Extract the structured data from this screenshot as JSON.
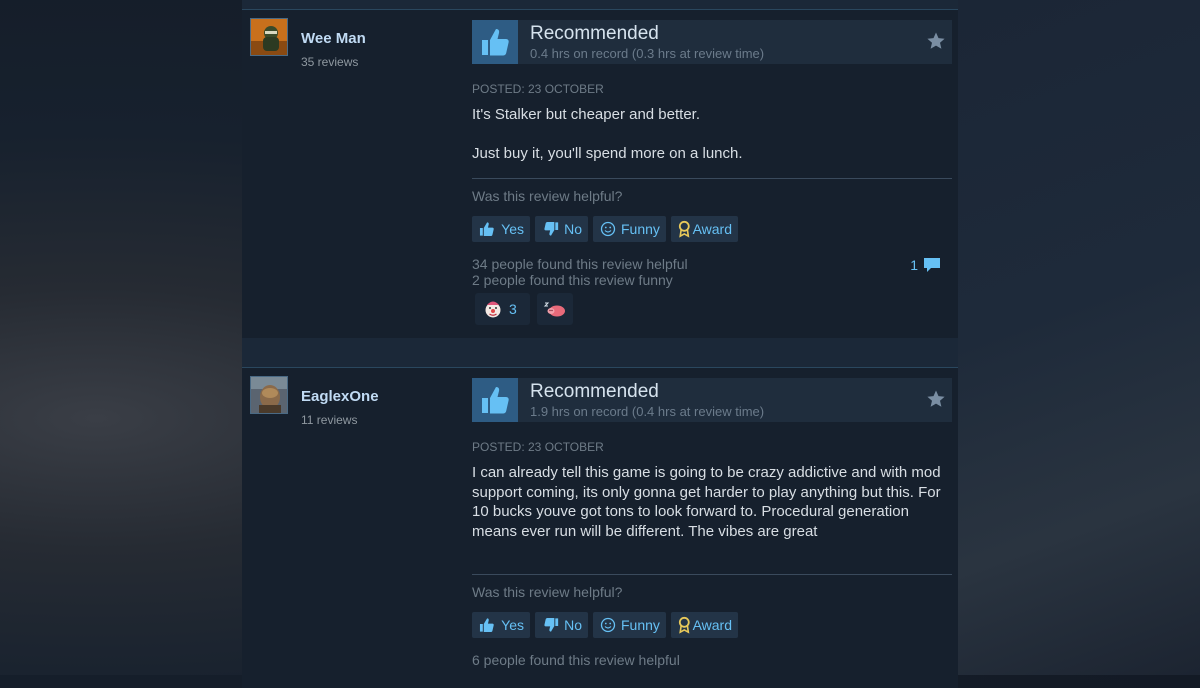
{
  "reviews": [
    {
      "author": "Wee Man",
      "author_reviews": "35 reviews",
      "verdict": "Recommended",
      "hours": "0.4 hrs on record (0.3 hrs at review time)",
      "posted": "Posted: 23 October",
      "body": [
        "It's Stalker but cheaper and better.",
        "Just buy it, you'll spend more on a lunch."
      ],
      "helpful_question": "Was this review helpful?",
      "buttons": {
        "yes": "Yes",
        "no": "No",
        "funny": "Funny",
        "award": "Award"
      },
      "helpful_count": "34 people found this review helpful",
      "funny_count": "2 people found this review funny",
      "comment_count": "1",
      "reactions": [
        {
          "icon": "clown-face-icon",
          "count": "3"
        },
        {
          "icon": "sleepy-pig-icon",
          "count": ""
        }
      ]
    },
    {
      "author": "EaglexOne",
      "author_reviews": "11 reviews",
      "verdict": "Recommended",
      "hours": "1.9 hrs on record (0.4 hrs at review time)",
      "posted": "Posted: 23 October",
      "body": [
        "I can already tell this game is going to be crazy addictive and with mod support coming, its only gonna get harder to play anything but this. For 10 bucks youve got tons to look forward to. Procedural generation means ever run will be different. The vibes are great"
      ],
      "helpful_question": "Was this review helpful?",
      "buttons": {
        "yes": "Yes",
        "no": "No",
        "funny": "Funny",
        "award": "Award"
      },
      "helpful_count": "6 people found this review helpful"
    }
  ],
  "colors": {
    "link_blue": "#66c0f4",
    "panel": "#16202d",
    "thumb_box": "#2e5c84",
    "award_gold": "#e8c95a"
  }
}
